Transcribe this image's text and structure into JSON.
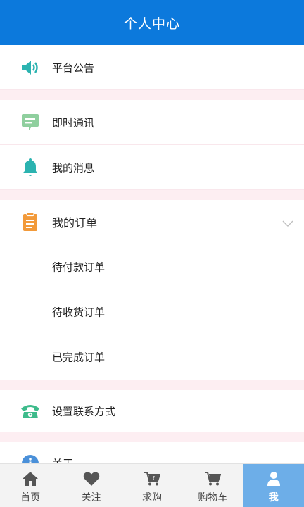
{
  "header": {
    "title": "个人中心"
  },
  "menu": {
    "announcement": "平台公告",
    "chat": "即时通讯",
    "messages": "我的消息",
    "orders": "我的订单",
    "pending_payment": "待付款订单",
    "pending_receipt": "待收货订单",
    "completed": "已完成订单",
    "contact": "设置联系方式",
    "about": "关于"
  },
  "tabbar": {
    "home": "首页",
    "follow": "关注",
    "wanted": "求购",
    "cart": "购物车",
    "me": "我"
  },
  "colors": {
    "header": "#0c79dc",
    "teal": "#2bb3b0",
    "green": "#3dbb8b",
    "orange": "#f29a3a",
    "active_tab": "#6daee8",
    "separator": "#fdeef2"
  }
}
